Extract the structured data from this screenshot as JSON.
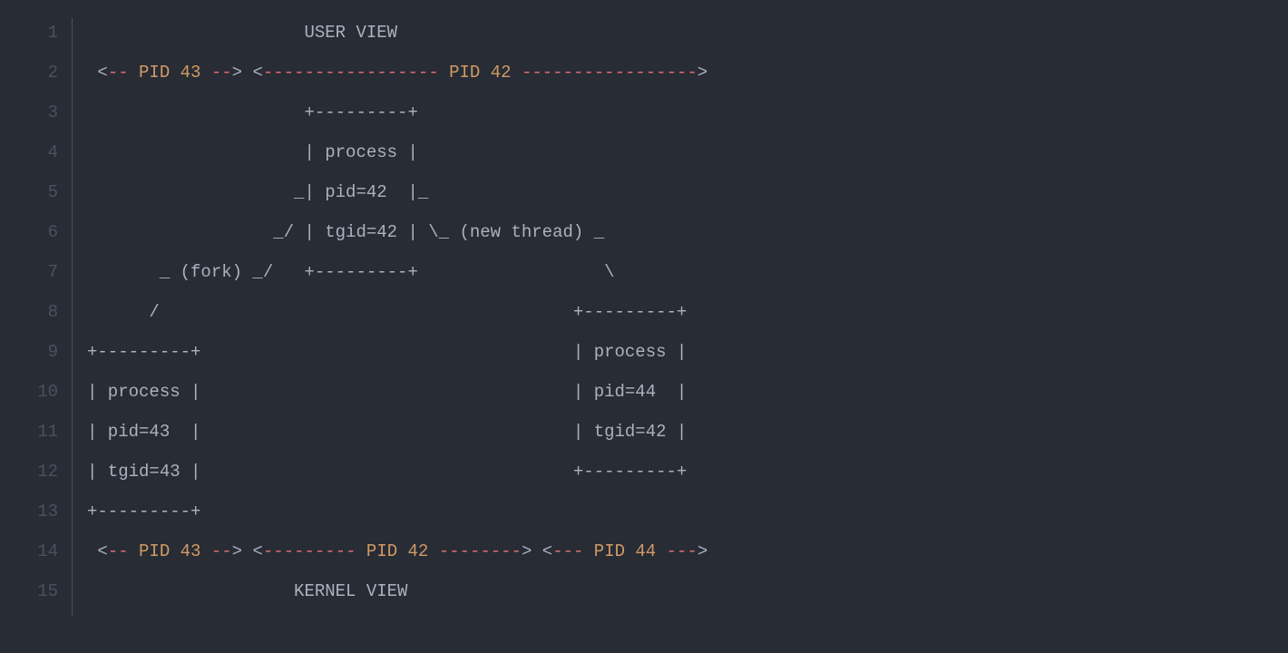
{
  "lines": [
    [
      {
        "cls": "c-default",
        "text": "                     USER VIEW"
      }
    ],
    [
      {
        "cls": "c-default",
        "text": " <"
      },
      {
        "cls": "c-red",
        "text": "-- "
      },
      {
        "cls": "c-orange",
        "text": "PID 43"
      },
      {
        "cls": "c-red",
        "text": " --"
      },
      {
        "cls": "c-default",
        "text": "> <"
      },
      {
        "cls": "c-red",
        "text": "----------------- "
      },
      {
        "cls": "c-orange",
        "text": "PID 42"
      },
      {
        "cls": "c-red",
        "text": " -----------------"
      },
      {
        "cls": "c-default",
        "text": ">"
      }
    ],
    [
      {
        "cls": "c-default",
        "text": "                     +---------+"
      }
    ],
    [
      {
        "cls": "c-default",
        "text": "                     | process |"
      }
    ],
    [
      {
        "cls": "c-default",
        "text": "                    _| pid=42  |_"
      }
    ],
    [
      {
        "cls": "c-default",
        "text": "                  _/ | tgid=42 | \\_ (new thread) _"
      }
    ],
    [
      {
        "cls": "c-default",
        "text": "       _ (fork) _/   +---------+                  \\"
      }
    ],
    [
      {
        "cls": "c-default",
        "text": "      /                                        +---------+"
      }
    ],
    [
      {
        "cls": "c-default",
        "text": "+---------+                                    | process |"
      }
    ],
    [
      {
        "cls": "c-default",
        "text": "| process |                                    | pid=44  |"
      }
    ],
    [
      {
        "cls": "c-default",
        "text": "| pid=43  |                                    | tgid=42 |"
      }
    ],
    [
      {
        "cls": "c-default",
        "text": "| tgid=43 |                                    +---------+"
      }
    ],
    [
      {
        "cls": "c-default",
        "text": "+---------+"
      }
    ],
    [
      {
        "cls": "c-default",
        "text": " <"
      },
      {
        "cls": "c-red",
        "text": "-- "
      },
      {
        "cls": "c-orange",
        "text": "PID 43"
      },
      {
        "cls": "c-red",
        "text": " --"
      },
      {
        "cls": "c-default",
        "text": "> <"
      },
      {
        "cls": "c-red",
        "text": "--------- "
      },
      {
        "cls": "c-orange",
        "text": "PID 42"
      },
      {
        "cls": "c-red",
        "text": " --------"
      },
      {
        "cls": "c-default",
        "text": "> <"
      },
      {
        "cls": "c-red",
        "text": "--- "
      },
      {
        "cls": "c-orange",
        "text": "PID 44"
      },
      {
        "cls": "c-red",
        "text": " ---"
      },
      {
        "cls": "c-default",
        "text": ">"
      }
    ],
    [
      {
        "cls": "c-default",
        "text": "                    KERNEL VIEW"
      }
    ]
  ]
}
